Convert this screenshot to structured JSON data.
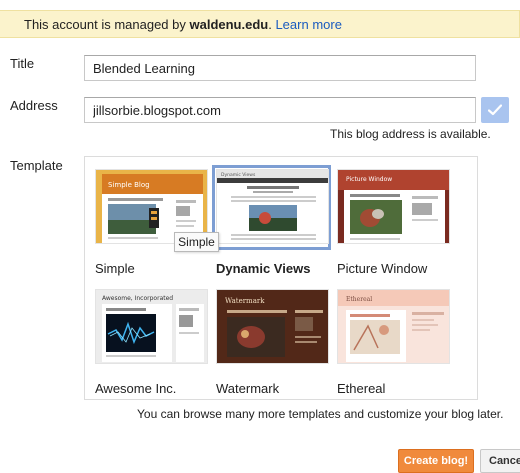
{
  "notice": {
    "prefix": "This account is managed by ",
    "domain": "waldenu.edu",
    "suffix": ". ",
    "link": "Learn more",
    "bg_color": "#fbf3cc"
  },
  "form": {
    "title_label": "Title",
    "title_value": "Blended Learning",
    "address_label": "Address",
    "address_value": "jillsorbie.blogspot.com",
    "address_check_icon": "checkmark-icon",
    "address_status": "This blog address is available.",
    "template_label": "Template"
  },
  "templates": [
    {
      "name": "Simple",
      "selected": false,
      "thumb_title": "Simple Blog"
    },
    {
      "name": "Dynamic Views",
      "selected": true,
      "thumb_title": "Dynamic Views"
    },
    {
      "name": "Picture Window",
      "selected": false,
      "thumb_title": "Picture Window"
    },
    {
      "name": "Awesome Inc.",
      "selected": false,
      "thumb_title": "Awesome, Incorporated"
    },
    {
      "name": "Watermark",
      "selected": false,
      "thumb_title": "Watermark"
    },
    {
      "name": "Ethereal",
      "selected": false,
      "thumb_title": "Ethereal"
    }
  ],
  "tooltip": "Simple",
  "browse_text": "You can browse many more templates and customize your blog later.",
  "buttons": {
    "create": "Create blog!",
    "cancel": "Cancel"
  },
  "colors": {
    "accent": "#f08a3c",
    "selection": "#7d9ed3",
    "link": "#1a5bbf"
  }
}
